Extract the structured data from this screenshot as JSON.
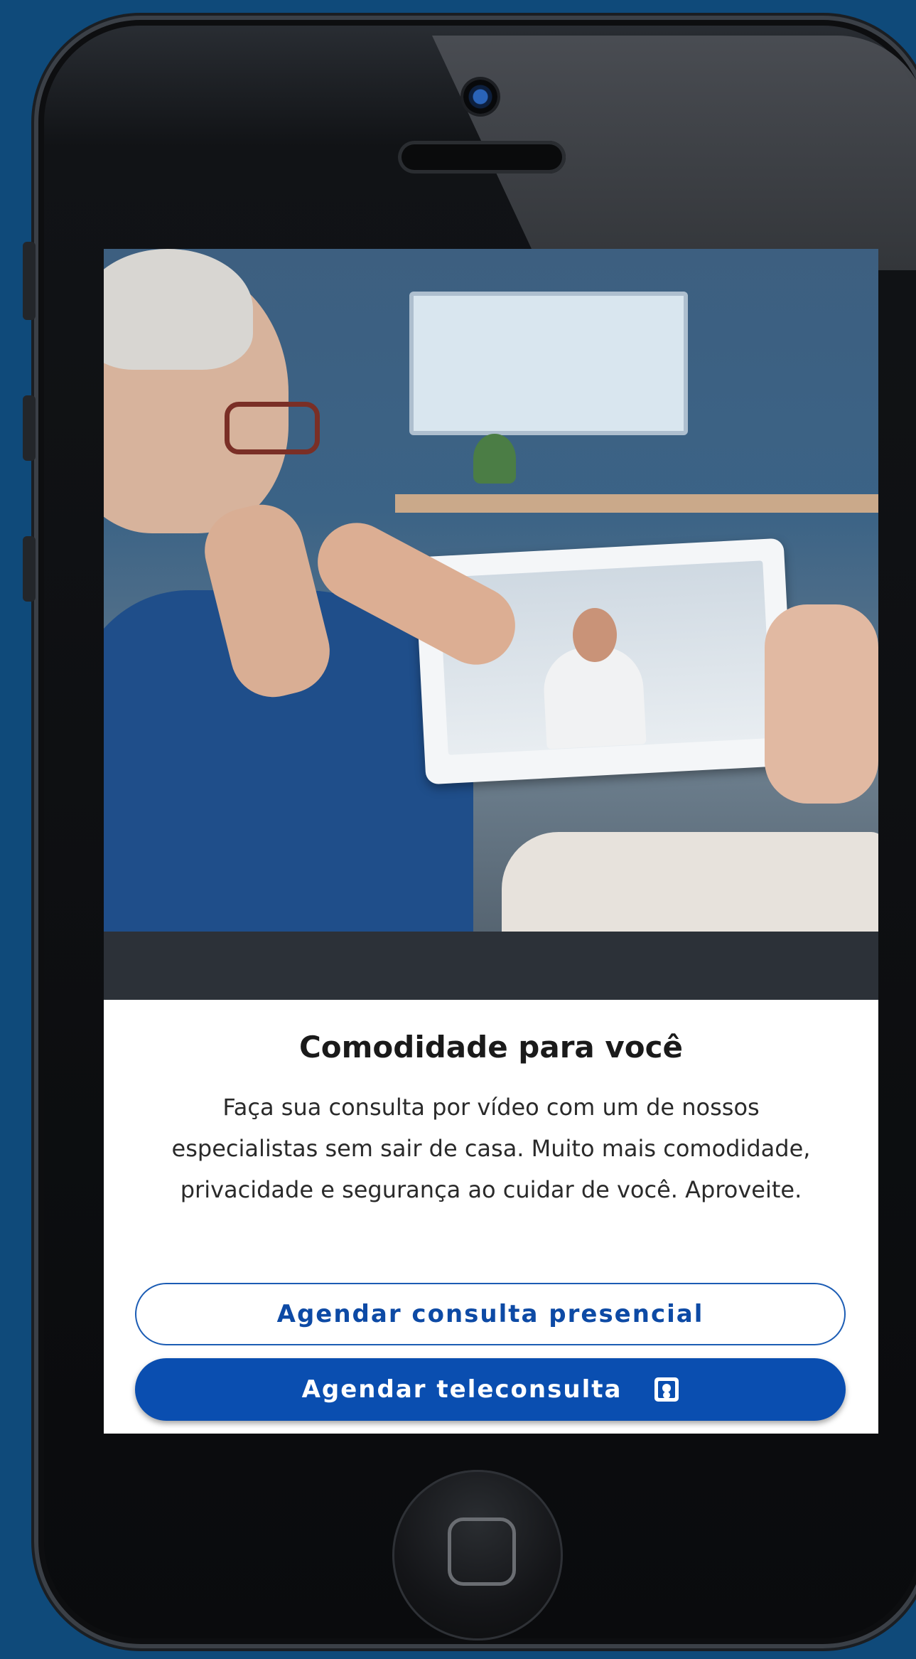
{
  "card": {
    "title": "Comodidade para você",
    "body": "Faça sua consulta por vídeo com um de nossos especialistas sem sair de casa. Muito mais comodidade, privacidade e segurança ao cuidar de você. Aproveite.",
    "image_alt": "Casal idoso em teleconsulta com médico pelo tablet"
  },
  "actions": {
    "in_person": "Agendar consulta presencial",
    "teleconsult": "Agendar teleconsulta",
    "teleconsult_icon": "video-consult-icon"
  },
  "colors": {
    "page_background": "#0f4a7a",
    "primary": "#0a4eb0",
    "primary_text": "#0d4aa5",
    "screen_background": "#ffffff"
  }
}
